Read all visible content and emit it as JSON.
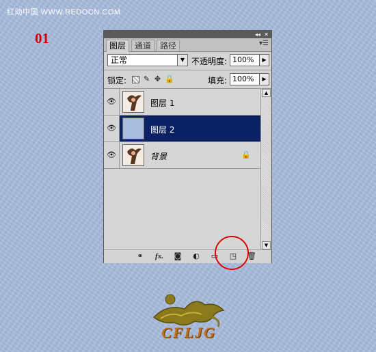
{
  "watermark": "红动中国 WWW.REDOCN.COM",
  "step_label": "01",
  "panel": {
    "tabs": [
      "图层",
      "通道",
      "路径"
    ],
    "blend_mode": "正常",
    "opacity_label": "不透明度:",
    "opacity_value": "100%",
    "lock_label": "锁定:",
    "fill_label": "填充:",
    "fill_value": "100%",
    "layers": [
      {
        "name": "图层 1",
        "selected": false
      },
      {
        "name": "图层 2",
        "selected": true
      },
      {
        "name": "背景",
        "selected": false,
        "locked": true
      }
    ],
    "bottom_icons": [
      "link-icon",
      "fx-icon",
      "mask-icon",
      "adjustment-icon",
      "folder-icon",
      "new-layer-icon",
      "trash-icon"
    ],
    "bottom_fx_label": "fx."
  },
  "logo_text": "CFLJG",
  "colors": {
    "background": "#a9bddf",
    "selected_layer": "#0a2164",
    "step_label": "#d10000",
    "highlight_circle": "#e00000"
  }
}
